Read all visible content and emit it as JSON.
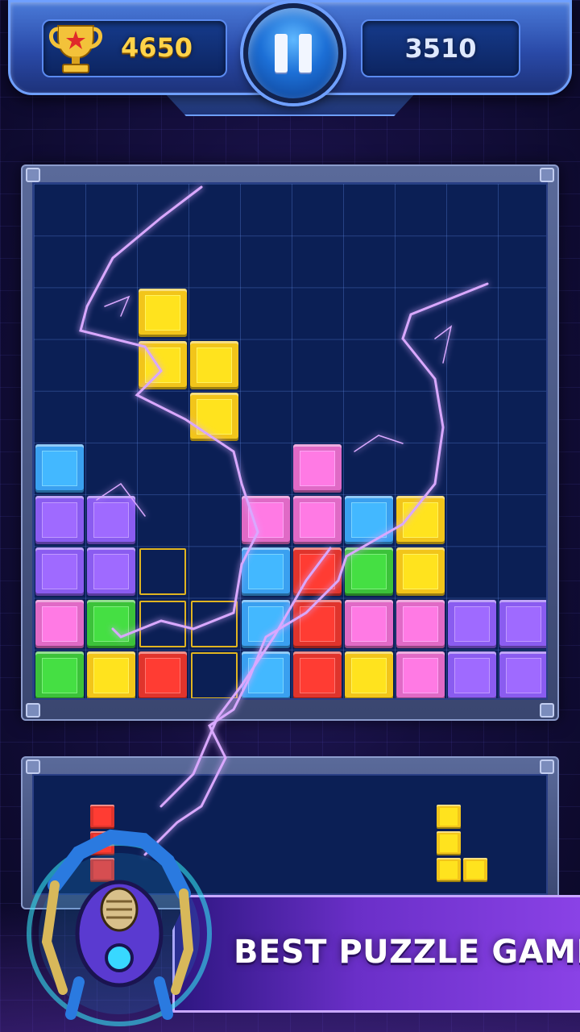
{
  "hud": {
    "best_score": "4650",
    "current_score": "3510",
    "trophy_icon": "trophy-icon",
    "pause_icon": "pause-icon"
  },
  "board": {
    "columns": 10,
    "rows": 10,
    "blocks": [
      {
        "col": 2,
        "row": 2,
        "color": "yellow"
      },
      {
        "col": 2,
        "row": 3,
        "color": "yellow"
      },
      {
        "col": 3,
        "row": 3,
        "color": "yellow"
      },
      {
        "col": 3,
        "row": 4,
        "color": "yellow"
      },
      {
        "col": 0,
        "row": 5,
        "color": "blue"
      },
      {
        "col": 5,
        "row": 5,
        "color": "pink"
      },
      {
        "col": 0,
        "row": 6,
        "color": "purple"
      },
      {
        "col": 1,
        "row": 6,
        "color": "purple"
      },
      {
        "col": 4,
        "row": 6,
        "color": "pink"
      },
      {
        "col": 5,
        "row": 6,
        "color": "pink"
      },
      {
        "col": 6,
        "row": 6,
        "color": "blue"
      },
      {
        "col": 7,
        "row": 6,
        "color": "yellow"
      },
      {
        "col": 0,
        "row": 7,
        "color": "purple"
      },
      {
        "col": 1,
        "row": 7,
        "color": "purple"
      },
      {
        "col": 4,
        "row": 7,
        "color": "blue"
      },
      {
        "col": 5,
        "row": 7,
        "color": "red"
      },
      {
        "col": 6,
        "row": 7,
        "color": "green"
      },
      {
        "col": 7,
        "row": 7,
        "color": "yellow"
      },
      {
        "col": 0,
        "row": 8,
        "color": "pink"
      },
      {
        "col": 1,
        "row": 8,
        "color": "green"
      },
      {
        "col": 4,
        "row": 8,
        "color": "blue"
      },
      {
        "col": 5,
        "row": 8,
        "color": "red"
      },
      {
        "col": 6,
        "row": 8,
        "color": "pink"
      },
      {
        "col": 7,
        "row": 8,
        "color": "pink"
      },
      {
        "col": 8,
        "row": 8,
        "color": "purple"
      },
      {
        "col": 9,
        "row": 8,
        "color": "purple"
      },
      {
        "col": 0,
        "row": 9,
        "color": "green"
      },
      {
        "col": 1,
        "row": 9,
        "color": "yellow"
      },
      {
        "col": 2,
        "row": 9,
        "color": "red"
      },
      {
        "col": 4,
        "row": 9,
        "color": "blue"
      },
      {
        "col": 5,
        "row": 9,
        "color": "red"
      },
      {
        "col": 6,
        "row": 9,
        "color": "yellow"
      },
      {
        "col": 7,
        "row": 9,
        "color": "pink"
      },
      {
        "col": 8,
        "row": 9,
        "color": "purple"
      },
      {
        "col": 9,
        "row": 9,
        "color": "purple"
      }
    ],
    "ghost_cells": [
      {
        "col": 2,
        "row": 7
      },
      {
        "col": 2,
        "row": 8
      },
      {
        "col": 3,
        "row": 8
      },
      {
        "col": 3,
        "row": 9
      }
    ]
  },
  "colors": {
    "yellow": "#f2c51a",
    "blue": "#3aa0f0",
    "pink": "#e06ac6",
    "purple": "#8a5cf0",
    "red": "#e0342c",
    "green": "#3cc23a"
  },
  "tray": {
    "pieces": [
      {
        "name": "piece-red",
        "color": "red",
        "cells": [
          [
            0,
            0
          ],
          [
            0,
            1
          ],
          [
            0,
            2
          ]
        ]
      },
      {
        "name": "piece-yellow-l",
        "color": "yellow",
        "cells": [
          [
            0,
            0
          ],
          [
            0,
            1
          ],
          [
            0,
            2
          ],
          [
            1,
            2
          ]
        ]
      }
    ]
  },
  "promo": {
    "text": "BEST PUZZLE GAME",
    "robot_icon": "robot-mascot-icon"
  }
}
